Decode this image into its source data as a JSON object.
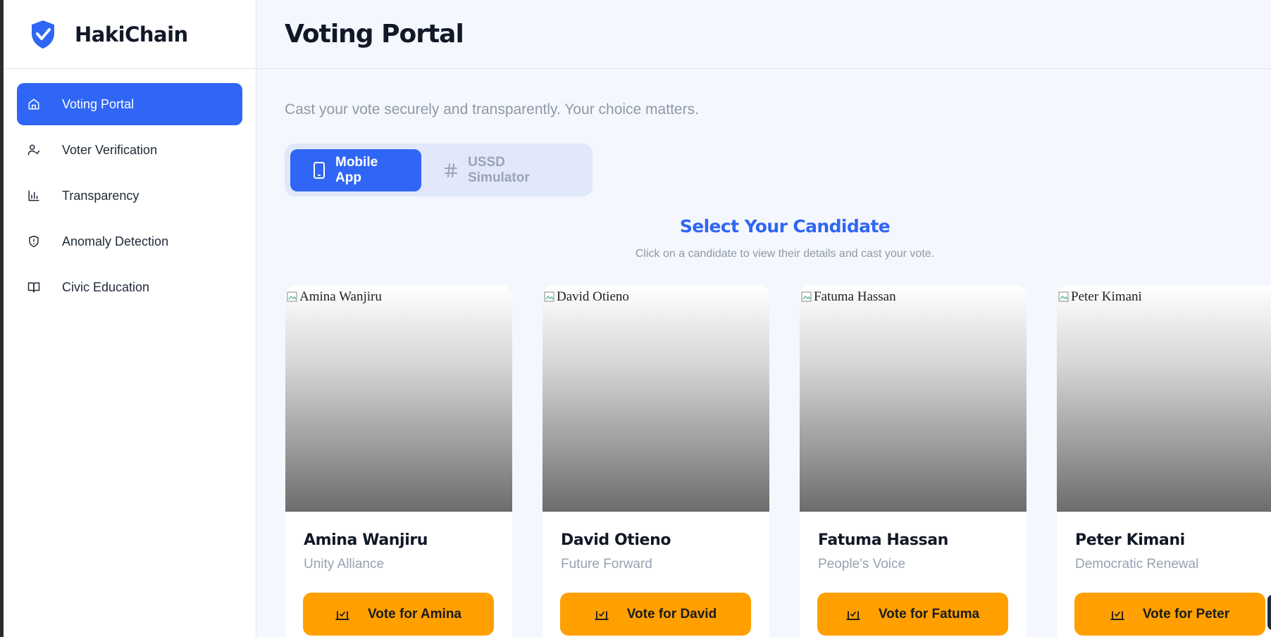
{
  "app": {
    "name": "HakiChain"
  },
  "sidebar": {
    "items": [
      {
        "label": "Voting Portal",
        "icon": "home-icon",
        "active": true
      },
      {
        "label": "Voter Verification",
        "icon": "user-check-icon",
        "active": false
      },
      {
        "label": "Transparency",
        "icon": "bar-chart-icon",
        "active": false
      },
      {
        "label": "Anomaly Detection",
        "icon": "shield-alert-icon",
        "active": false
      },
      {
        "label": "Civic Education",
        "icon": "book-open-icon",
        "active": false
      }
    ]
  },
  "header": {
    "title": "Voting Portal"
  },
  "main": {
    "subtitle": "Cast your vote securely and transparently. Your choice matters.",
    "modes": [
      {
        "label": "Mobile App",
        "icon": "smartphone-icon",
        "active": true
      },
      {
        "label": "USSD Simulator",
        "icon": "hash-icon",
        "active": false
      }
    ],
    "section_title": "Select Your Candidate",
    "section_subtitle": "Click on a candidate to view their details and cast your vote.",
    "candidates": [
      {
        "name": "Amina Wanjiru",
        "party": "Unity Alliance",
        "vote_label": "Vote for Amina",
        "photo_alt": "Amina Wanjiru"
      },
      {
        "name": "David Otieno",
        "party": "Future Forward",
        "vote_label": "Vote for David",
        "photo_alt": "David Otieno"
      },
      {
        "name": "Fatuma Hassan",
        "party": "People's Voice",
        "vote_label": "Vote for Fatuma",
        "photo_alt": "Fatuma Hassan"
      },
      {
        "name": "Peter Kimani",
        "party": "Democratic Renewal",
        "vote_label": "Vote for Peter",
        "photo_alt": "Peter Kimani"
      }
    ]
  },
  "colors": {
    "primary": "#2f66f5",
    "accent": "#ffa000",
    "background": "#f4f7fd",
    "muted_text": "#8f99a8"
  }
}
